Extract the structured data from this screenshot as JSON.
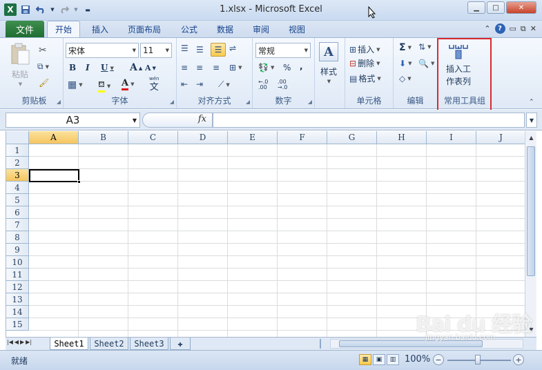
{
  "window": {
    "title": "1.xlsx  -  Microsoft Excel"
  },
  "qat": {
    "logo": "X",
    "save_icon": "save-icon",
    "undo_icon": "undo-icon",
    "redo_icon": "redo-icon",
    "customize_icon": "chevron-down-icon"
  },
  "tabs": {
    "file": "文件",
    "items": [
      "开始",
      "插入",
      "页面布局",
      "公式",
      "数据",
      "审阅",
      "视图"
    ],
    "active": "开始"
  },
  "ribbon": {
    "clipboard": {
      "label": "剪贴板",
      "paste": "粘贴"
    },
    "font": {
      "label": "字体",
      "font_name": "宋体",
      "font_size": "11",
      "bold": "B",
      "italic": "I",
      "underline": "U",
      "grow": "A",
      "shrink": "A",
      "font_color_glyph": "A",
      "phonetic": "wén",
      "phonetic_char": "文"
    },
    "alignment": {
      "label": "对齐方式"
    },
    "number": {
      "label": "数字",
      "format": "常规",
      "percent": "%",
      "comma": ",",
      "inc_decimal": "←.0 .00",
      "dec_decimal": ".00 →.0"
    },
    "styles": {
      "label": "样式"
    },
    "cells": {
      "label": "单元格",
      "insert": "插入",
      "delete": "删除",
      "format": "格式"
    },
    "editing": {
      "label": "编辑",
      "sum": "Σ"
    },
    "custom": {
      "label": "常用工具组",
      "button_line1": "插入工",
      "button_line2": "作表列"
    }
  },
  "formula": {
    "name_box": "A3",
    "fx": "fx",
    "value": ""
  },
  "columns": [
    "A",
    "B",
    "C",
    "D",
    "E",
    "F",
    "G",
    "H",
    "I",
    "J"
  ],
  "rows": [
    "1",
    "2",
    "3",
    "4",
    "5",
    "6",
    "7",
    "8",
    "9",
    "10",
    "11",
    "12",
    "13",
    "14",
    "15"
  ],
  "selected": {
    "column": "A",
    "row": "3"
  },
  "sheets": [
    "Sheet1",
    "Sheet2",
    "Sheet3"
  ],
  "active_sheet": "Sheet1",
  "status": {
    "text": "就绪",
    "zoom": "100%"
  },
  "watermark": {
    "main": "Bai du 经验",
    "sub": "jingyan.baidu.com"
  },
  "colors": {
    "file_tab": "#1f6d32",
    "highlight_box": "#d9292e",
    "selection": "#f5c55f"
  }
}
